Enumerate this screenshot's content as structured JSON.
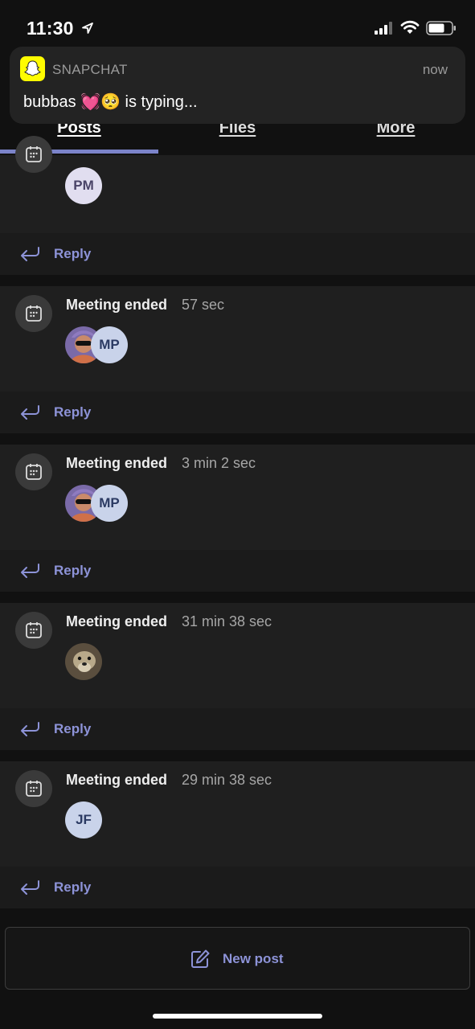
{
  "status": {
    "time": "11:30"
  },
  "notification": {
    "app": "SNAPCHAT",
    "time": "now",
    "text": "bubbas 💓🥺 is typing..."
  },
  "tabs": [
    {
      "label": "Posts",
      "active": true
    },
    {
      "label": "Files",
      "active": false
    },
    {
      "label": "More",
      "active": false
    }
  ],
  "posts": [
    {
      "title": "",
      "duration": "",
      "avatars": [
        "PM"
      ],
      "reply": "Reply"
    },
    {
      "title": "Meeting ended",
      "duration": "57 sec",
      "avatars": [
        "photo",
        "MP"
      ],
      "reply": "Reply"
    },
    {
      "title": "Meeting ended",
      "duration": "3 min 2 sec",
      "avatars": [
        "photo",
        "MP"
      ],
      "reply": "Reply"
    },
    {
      "title": "Meeting ended",
      "duration": "31 min 38 sec",
      "avatars": [
        "photo-dog"
      ],
      "reply": "Reply"
    },
    {
      "title": "Meeting ended",
      "duration": "29 min 38 sec",
      "avatars": [
        "JF"
      ],
      "reply": "Reply"
    }
  ],
  "new_post": {
    "label": "New post"
  },
  "colors": {
    "accent": "#7b83c9",
    "link": "#8d93d8",
    "background": "#111111",
    "card": "#1f1f1f"
  }
}
